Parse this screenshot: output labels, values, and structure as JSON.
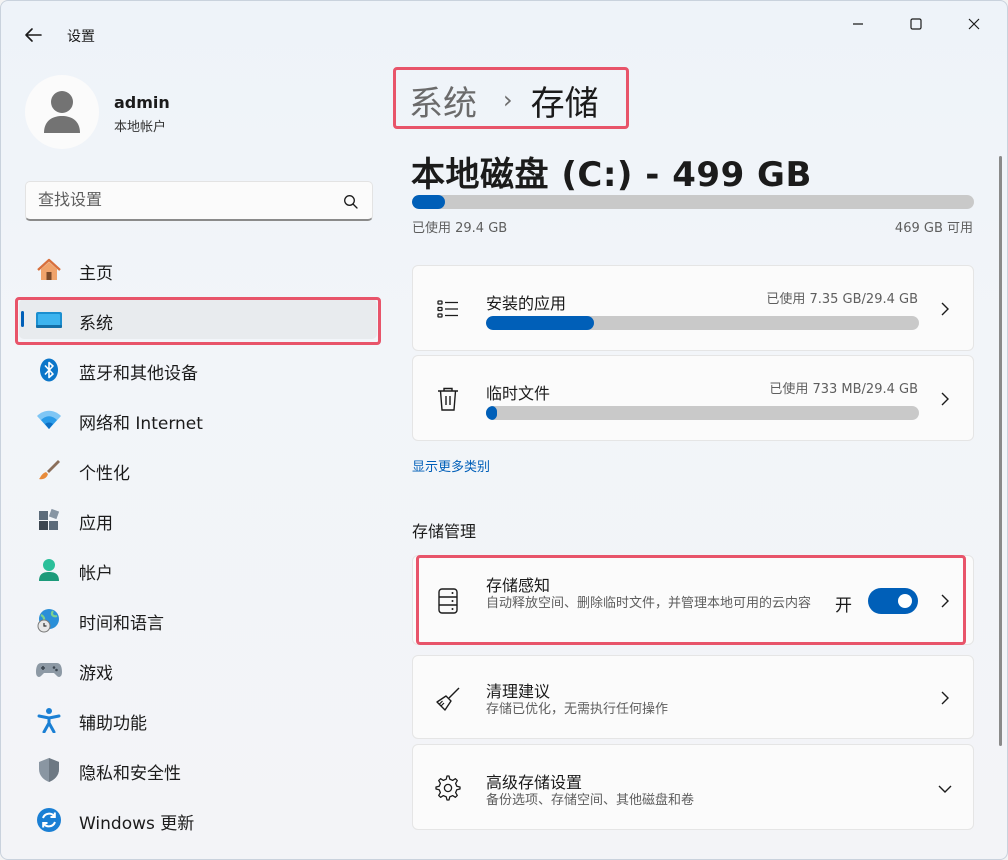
{
  "window": {
    "app_title": "设置",
    "controls": {
      "minimize": "minimize",
      "maximize": "maximize",
      "close": "close"
    }
  },
  "user": {
    "name": "admin",
    "account_type": "本地帐户"
  },
  "search": {
    "placeholder": "查找设置"
  },
  "sidebar": {
    "selected_index": 1,
    "items": [
      {
        "label": "主页",
        "icon": "home-icon"
      },
      {
        "label": "系统",
        "icon": "system-icon"
      },
      {
        "label": "蓝牙和其他设备",
        "icon": "bluetooth-icon"
      },
      {
        "label": "网络和 Internet",
        "icon": "wifi-icon"
      },
      {
        "label": "个性化",
        "icon": "brush-icon"
      },
      {
        "label": "应用",
        "icon": "apps-icon"
      },
      {
        "label": "帐户",
        "icon": "account-icon"
      },
      {
        "label": "时间和语言",
        "icon": "globe-clock-icon"
      },
      {
        "label": "游戏",
        "icon": "gamepad-icon"
      },
      {
        "label": "辅助功能",
        "icon": "accessibility-icon"
      },
      {
        "label": "隐私和安全性",
        "icon": "shield-icon"
      },
      {
        "label": "Windows 更新",
        "icon": "update-icon"
      }
    ]
  },
  "breadcrumb": {
    "parent": "系统",
    "separator": "›",
    "current": "存储"
  },
  "disk": {
    "title": "本地磁盘 (C:) - 499 GB",
    "used_label": "已使用 29.4 GB",
    "free_label": "469 GB 可用",
    "used_fraction": 0.059
  },
  "categories": [
    {
      "title": "安装的应用",
      "meta": "已使用 7.35 GB/29.4 GB",
      "fraction": 0.25,
      "icon": "list-icon"
    },
    {
      "title": "临时文件",
      "meta": "已使用 733 MB/29.4 GB",
      "fraction": 0.024,
      "icon": "trash-icon"
    }
  ],
  "show_more": "显示更多类别",
  "management": {
    "section_title": "存储管理",
    "storage_sense": {
      "title": "存储感知",
      "subtitle": "自动释放空间、删除临时文件，并管理本地可用的云内容",
      "toggle_label": "开",
      "toggle_on": true,
      "icon": "storage-icon"
    },
    "cleanup": {
      "title": "清理建议",
      "subtitle": "存储已优化，无需执行任何操作",
      "icon": "broom-icon"
    },
    "advanced": {
      "title": "高级存储设置",
      "subtitle": "备份选项、存储空间、其他磁盘和卷",
      "icon": "gear-icon"
    }
  },
  "colors": {
    "accent": "#005fb8",
    "highlight": "#e8546a",
    "bar_track": "#c9c9c9"
  }
}
